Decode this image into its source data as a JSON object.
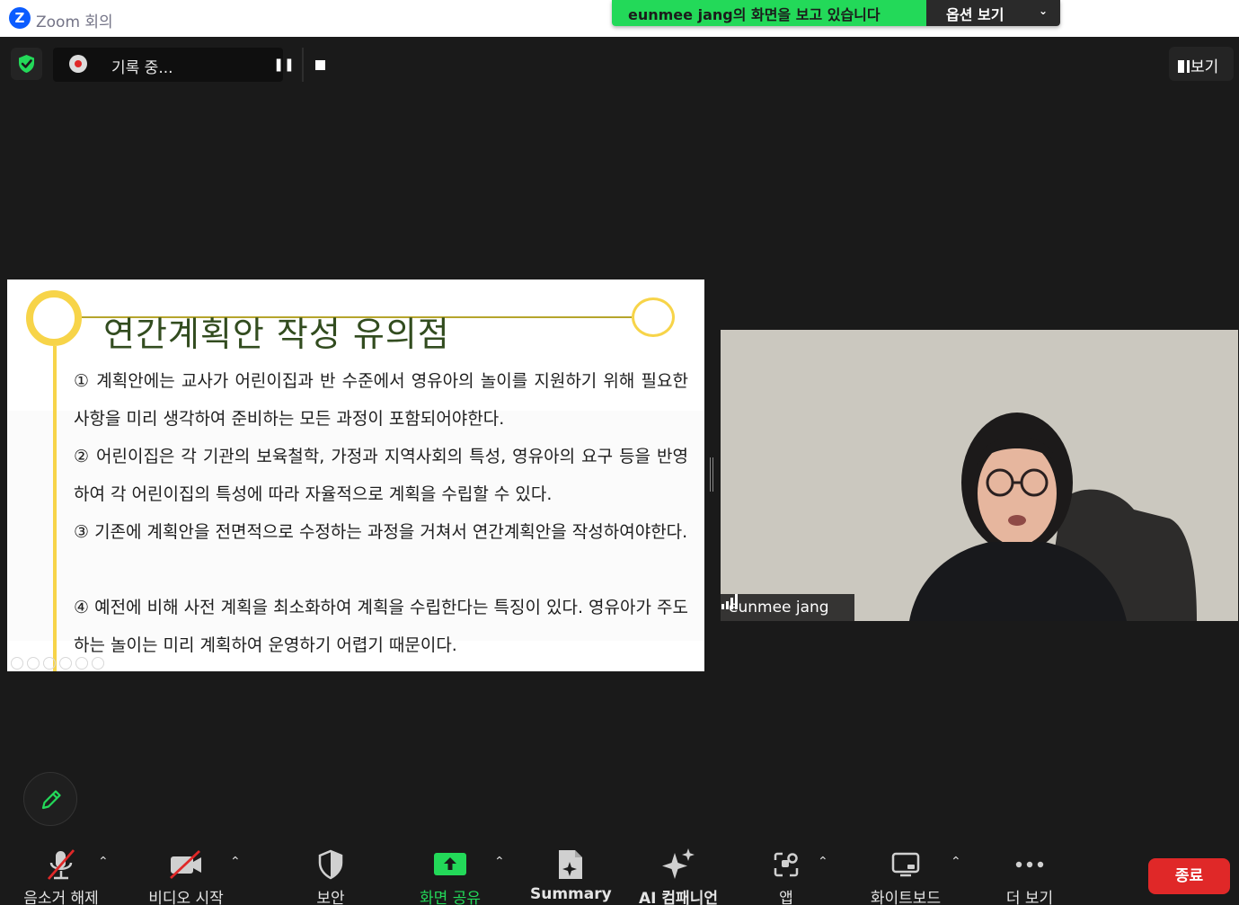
{
  "window": {
    "title": "Zoom 회의",
    "logo_letter": "Z"
  },
  "share_banner": {
    "text": "eunmee jang의 화면을 보고 있습니다",
    "options_label": "옵션 보기"
  },
  "recording": {
    "label": "기록 중..."
  },
  "view_button": {
    "label": "보기"
  },
  "slide": {
    "title": "연간계획안 작성 유의점",
    "paragraphs": [
      "① 계획안에는 교사가 어린이집과 반 수준에서 영유아의 놀이를 지원하기 위해 필요한 사항을 미리 생각하여 준비하는 모든 과정이 포함되어야한다.",
      "② 어린이집은 각 기관의 보육철학, 가정과 지역사회의 특성, 영유아의 요구 등을 반영하여 각 어린이집의 특성에 따라 자율적으로 계획을 수립할 수 있다.",
      "③ 기존에 계획안을 전면적으로 수정하는 과정을 거쳐서 연간계획안을 작성하여야한다.",
      "④ 예전에 비해 사전 계획을 최소화하여 계획을 수립한다는 특징이 있다. 영유아가 주도하는 놀이는 미리 계획하여 운영하기 어렵기 때문이다."
    ]
  },
  "participant": {
    "name": "eunmee jang"
  },
  "toolbar": {
    "mute_label": "음소거 해제",
    "video_label": "비디오 시작",
    "security_label": "보안",
    "share_label": "화면 공유",
    "summary_label": "Summary",
    "ai_label": "AI 컴패니언",
    "apps_label": "앱",
    "whiteboard_label": "화이트보드",
    "more_label": "더 보기",
    "end_label": "종료"
  },
  "colors": {
    "accent_green": "#23d959",
    "end_red": "#e02828",
    "slide_gold": "#f7d449",
    "slide_title": "#324c1f"
  }
}
